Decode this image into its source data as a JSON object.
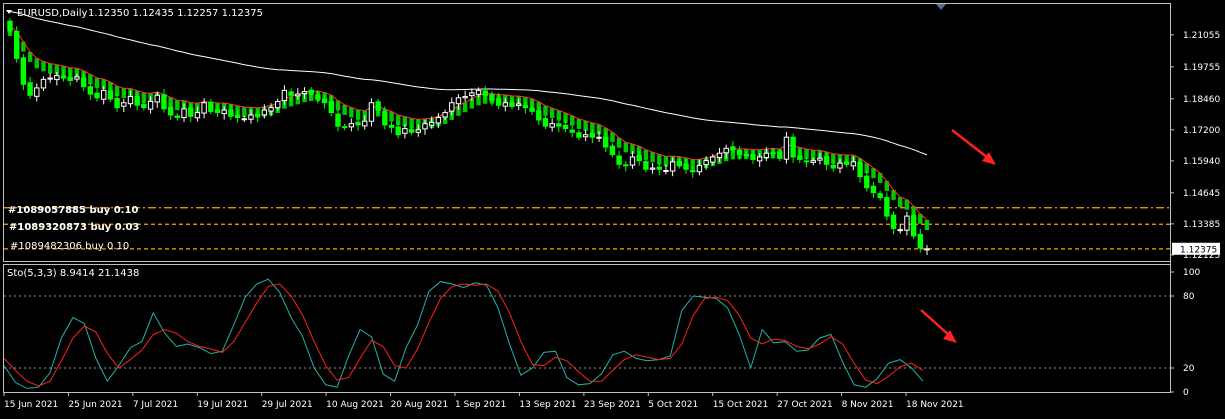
{
  "header": {
    "symbol": "EURUSD,Daily",
    "ohlc": "1.12350 1.12435 1.12257 1.12375"
  },
  "indicator": {
    "label": "Sto(5,3,3) 8.9414 21.1438",
    "levels": [
      20,
      80
    ]
  },
  "orders": [
    {
      "label": "#1089057885 buy 0.10"
    },
    {
      "label": "#1089320873 buy 0.03"
    },
    {
      "label": "#1089482306 buy 0.10"
    }
  ],
  "colors": {
    "background": "#000000",
    "grid_border": "#c0c0c0",
    "bull_candle": "#ffffff",
    "bear_candle": "#00ff00",
    "ribbon_fill": "#00c800",
    "ribbon_edge": "#ff3030",
    "ma_line": "#ffffff",
    "stoch_main": "#20b2aa",
    "stoch_signal": "#ff2020",
    "order_line": "#ffa500",
    "arrow": "#ff2020"
  },
  "chart_data": [
    {
      "type": "candlestick",
      "symbol": "EURUSD",
      "timeframe": "Daily",
      "price_labels": [
        "1.21055",
        "1.19755",
        "1.18460",
        "1.17200",
        "1.15940",
        "1.14645",
        "1.13385",
        "1.12125"
      ],
      "ylim": [
        1.12,
        1.219
      ],
      "current_price": "1.12375",
      "x_labels": [
        "15 Jun 2021",
        "25 Jun 2021",
        "7 Jul 2021",
        "19 Jul 2021",
        "29 Jul 2021",
        "10 Aug 2021",
        "20 Aug 2021",
        "1 Sep 2021",
        "13 Sep 2021",
        "23 Sep 2021",
        "5 Oct 2021",
        "15 Oct 2021",
        "27 Oct 2021",
        "8 Nov 2021",
        "18 Nov 2021"
      ],
      "close": [
        1.2121,
        1.201,
        1.1905,
        1.186,
        1.189,
        1.1925,
        1.193,
        1.194,
        1.193,
        1.192,
        1.1935,
        1.1895,
        1.1865,
        1.185,
        1.188,
        1.1845,
        1.181,
        1.183,
        1.1855,
        1.182,
        1.181,
        1.1835,
        1.186,
        1.1805,
        1.178,
        1.177,
        1.1805,
        1.1775,
        1.179,
        1.183,
        1.1795,
        1.179,
        1.18,
        1.1775,
        1.177,
        1.1765,
        1.178,
        1.1775,
        1.18,
        1.181,
        1.1835,
        1.188,
        1.186,
        1.1865,
        1.1875,
        1.1865,
        1.1845,
        1.183,
        1.179,
        1.1735,
        1.173,
        1.1745,
        1.174,
        1.1755,
        1.183,
        1.18,
        1.174,
        1.173,
        1.17,
        1.1725,
        1.171,
        1.172,
        1.1745,
        1.175,
        1.177,
        1.179,
        1.183,
        1.185,
        1.1855,
        1.187,
        1.188,
        1.186,
        1.184,
        1.182,
        1.183,
        1.1815,
        1.1825,
        1.181,
        1.1795,
        1.176,
        1.1735,
        1.1745,
        1.1735,
        1.1725,
        1.171,
        1.169,
        1.17,
        1.169,
        1.169,
        1.165,
        1.162,
        1.158,
        1.1575,
        1.161,
        1.1595,
        1.156,
        1.1565,
        1.156,
        1.1555,
        1.159,
        1.1575,
        1.156,
        1.155,
        1.1575,
        1.1595,
        1.161,
        1.1625,
        1.1645,
        1.164,
        1.162,
        1.1615,
        1.16,
        1.161,
        1.1625,
        1.1625,
        1.1605,
        1.169,
        1.161,
        1.16,
        1.159,
        1.1595,
        1.1605,
        1.158,
        1.1565,
        1.1585,
        1.158,
        1.159,
        1.153,
        1.1485,
        1.1465,
        1.1445,
        1.137,
        1.132,
        1.1315,
        1.137,
        1.129,
        1.124,
        1.1237
      ]
    },
    {
      "type": "line",
      "name": "Sto(5,3,3)",
      "ylim": [
        0,
        100
      ],
      "levels": [
        20,
        80
      ],
      "tick_labels": [
        "100",
        "80",
        "20",
        "0"
      ],
      "main": [
        22,
        8,
        3,
        4,
        16,
        45,
        62,
        57,
        28,
        9,
        22,
        37,
        42,
        66,
        49,
        38,
        40,
        37,
        32,
        34,
        56,
        79,
        90,
        94,
        83,
        62,
        46,
        20,
        6,
        4,
        30,
        52,
        46,
        15,
        9,
        37,
        56,
        84,
        92,
        90,
        87,
        91,
        89,
        70,
        40,
        14,
        20,
        33,
        34,
        12,
        6,
        7,
        15,
        31,
        34,
        28,
        26,
        27,
        30,
        68,
        80,
        79,
        78,
        70,
        48,
        20,
        52,
        41,
        42,
        34,
        35,
        45,
        48,
        25,
        6,
        4,
        11,
        24,
        27,
        20,
        9
      ],
      "signal": [
        28,
        18,
        9,
        5,
        9,
        26,
        45,
        55,
        50,
        32,
        20,
        27,
        35,
        48,
        52,
        49,
        42,
        38,
        36,
        33,
        42,
        58,
        74,
        88,
        90,
        80,
        64,
        42,
        22,
        10,
        12,
        28,
        43,
        38,
        22,
        20,
        36,
        58,
        78,
        88,
        90,
        89,
        90,
        84,
        66,
        42,
        23,
        22,
        29,
        26,
        17,
        9,
        9,
        18,
        27,
        31,
        29,
        27,
        28,
        40,
        64,
        78,
        79,
        76,
        64,
        45,
        40,
        44,
        43,
        38,
        36,
        40,
        46,
        40,
        24,
        10,
        7,
        13,
        21,
        24,
        18
      ]
    }
  ]
}
